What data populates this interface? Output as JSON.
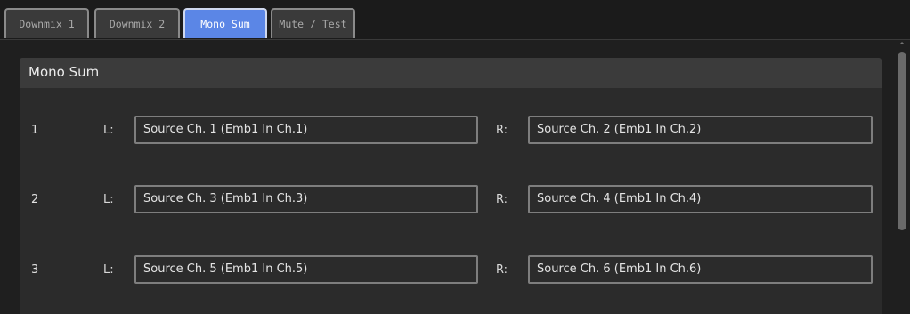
{
  "tabs": [
    {
      "label": "Downmix 1",
      "active": false
    },
    {
      "label": "Downmix 2",
      "active": false
    },
    {
      "label": "Mono Sum",
      "active": true
    },
    {
      "label": "Mute / Test",
      "active": false
    }
  ],
  "panel": {
    "title": "Mono Sum",
    "left_label": "L:",
    "right_label": "R:",
    "rows": [
      {
        "number": "1",
        "left": "Source Ch. 1 (Emb1 In Ch.1)",
        "right": "Source Ch. 2 (Emb1 In Ch.2)"
      },
      {
        "number": "2",
        "left": "Source Ch. 3 (Emb1 In Ch.3)",
        "right": "Source Ch. 4 (Emb1 In Ch.4)"
      },
      {
        "number": "3",
        "left": "Source Ch. 5 (Emb1 In Ch.5)",
        "right": "Source Ch. 6 (Emb1 In Ch.6)"
      }
    ]
  },
  "colors": {
    "active_tab": "#5b86e6",
    "background": "#1f1f1f",
    "panel_header": "#3b3b3b",
    "panel_body": "#2b2b2b"
  },
  "icons": {
    "scroll_up": "chevron-up-icon"
  }
}
